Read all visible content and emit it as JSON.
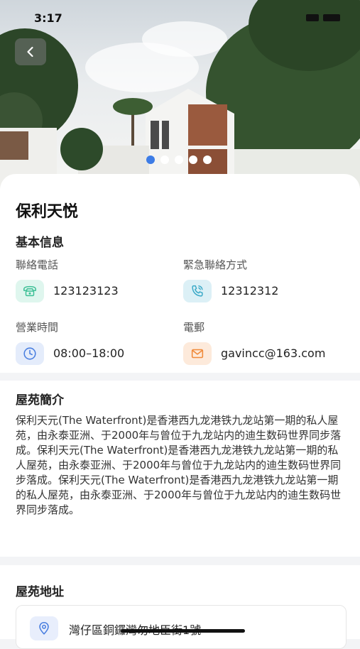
{
  "status_bar": {
    "time": "3:17"
  },
  "hero": {
    "dots_count": 5,
    "active_index": 0
  },
  "property": {
    "name": "保利天悦"
  },
  "basic_info": {
    "section_title": "基本信息",
    "phone": {
      "label": "聯絡電話",
      "value": "123123123",
      "icon": "telephone-icon",
      "color": "#3cbf95"
    },
    "emergency": {
      "label": "緊急聯絡方式",
      "value": "12312312",
      "icon": "emergency-phone-icon",
      "color": "#3aa9c7"
    },
    "hours": {
      "label": "營業時間",
      "value": "08:00–18:00",
      "icon": "clock-icon",
      "color": "#4a7fe0"
    },
    "email": {
      "label": "電郵",
      "value": "gavincc@163.com",
      "icon": "mail-icon",
      "color": "#f08a3a"
    }
  },
  "intro": {
    "section_title": "屋苑簡介",
    "text": "保利天元(The Waterfront)是香港西九龙港铁九龙站第一期的私人屋苑，由永泰亚洲、于2000年与曾位于九龙站内的迪生数码世界同步落成。保利天元(The Waterfront)是香港西九龙港铁九龙站第一期的私人屋苑，由永泰亚洲、于2000年与曾位于九龙站内的迪生数码世界同步落成。保利天元(The Waterfront)是香港西九龙港铁九龙站第一期的私人屋苑，由永泰亚洲、于2000年与曾位于九龙站内的迪生数码世界同步落成。"
  },
  "address": {
    "section_title": "屋苑地址",
    "value": "灣仔區銅鑼灣勿地臣街1號",
    "icon": "location-pin-icon"
  }
}
